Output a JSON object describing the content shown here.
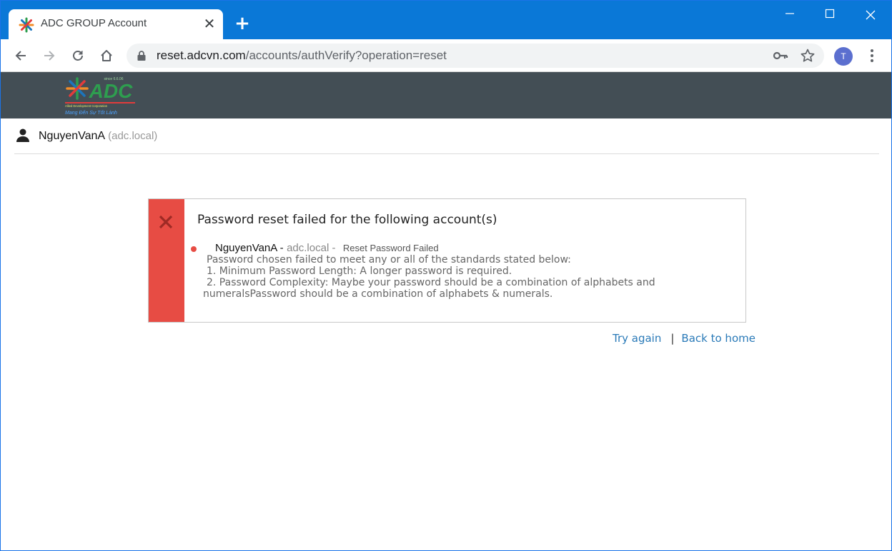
{
  "browser": {
    "tab_title": "ADC GROUP Account",
    "url_host": "reset.adcvn.com",
    "url_path": "/accounts/authVerify?operation=reset",
    "profile_initial": "T",
    "icons": [
      "back-icon",
      "forward-icon",
      "reload-icon",
      "home-icon",
      "lock-icon",
      "key-icon",
      "star-icon",
      "more-icon"
    ]
  },
  "header": {
    "logo_text": "ADC",
    "logo_caption": "Allied Development Corporation",
    "logo_slogan": "Mang Đến Sự Tốt Lành",
    "logo_since": "since 6.6.06"
  },
  "user": {
    "name": "NguyenVanA",
    "domain": "(adc.local)"
  },
  "alert": {
    "title": "Password reset failed for the following account(s)",
    "account_user": "NguyenVanA -",
    "account_domain": "adc.local -",
    "account_status": "Reset Password Failed",
    "message_line1": "Password chosen failed to meet any or all of the standards stated below:",
    "message_line2": "1. Minimum Password Length: A longer password is required.",
    "message_line3": "2. Password Complexity: Maybe your password should be a combination of alphabets and",
    "message_line4": "numeralsPassword should be a combination of alphabets & numerals.",
    "accent_color": "#e74c44"
  },
  "links": {
    "try_again": "Try again",
    "separator": "|",
    "back_home": "Back to home"
  }
}
